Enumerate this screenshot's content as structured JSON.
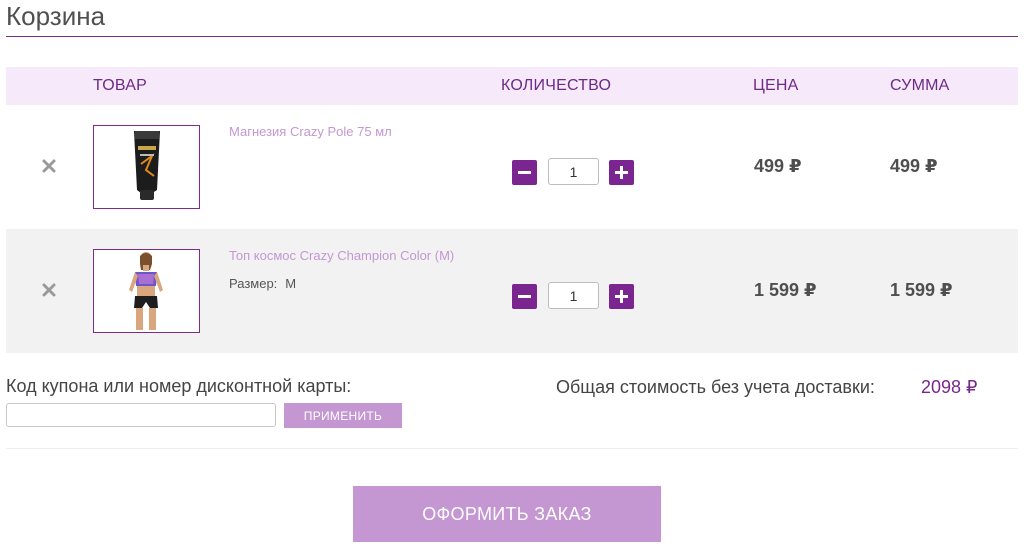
{
  "page": {
    "title": "Корзина"
  },
  "table": {
    "headers": {
      "product": "ТОВАР",
      "quantity": "КОЛИЧЕСТВО",
      "price": "ЦЕНА",
      "sum": "СУММА"
    },
    "items": [
      {
        "name": "Магнезия Crazy Pole 75 мл",
        "image": "magnesia-tube-image",
        "quantity": "1",
        "price": "499 ₽",
        "sum": "499 ₽"
      },
      {
        "name": "Топ космос Crazy Champion Color (M)",
        "image": "sport-top-model-image",
        "property_label": "Размер:",
        "property_value": "M",
        "quantity": "1",
        "price": "1 599 ₽",
        "sum": "1 599 ₽"
      }
    ]
  },
  "coupon": {
    "label": "Код купона или номер дисконтной карты:",
    "value": "",
    "apply_label": "ПРИМЕНИТЬ"
  },
  "total": {
    "label": "Общая стоимость без учета доставки:",
    "value": "2098 ₽"
  },
  "checkout": {
    "label": "ОФОРМИТЬ ЗАКАЗ"
  },
  "icons": {
    "remove": "close-icon",
    "minus": "minus-icon",
    "plus": "plus-icon"
  },
  "colors": {
    "accent": "#7b2590",
    "accent_light": "#c497d2",
    "header_bg": "#f5e9fa",
    "row_alt_bg": "#f2f2f2"
  }
}
